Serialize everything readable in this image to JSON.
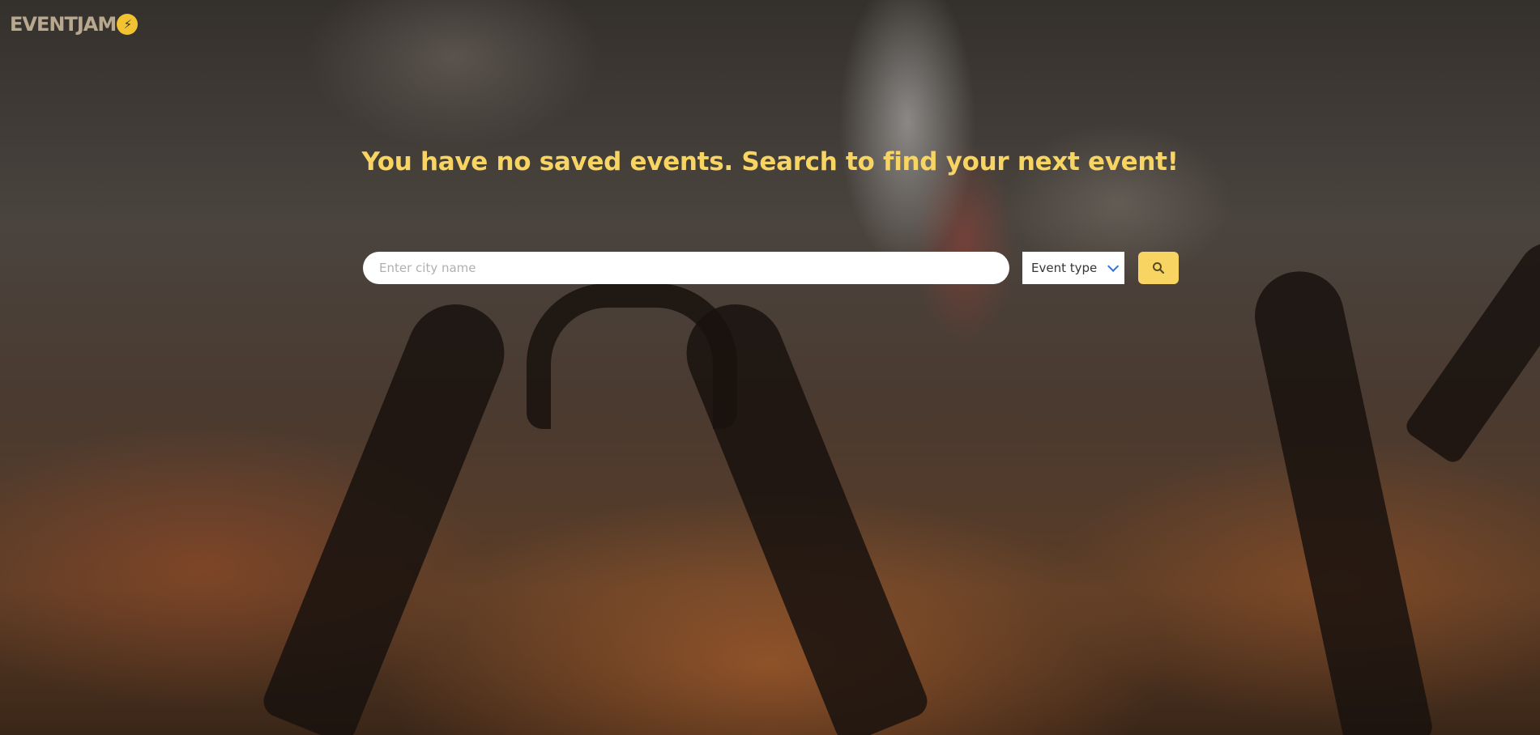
{
  "brand": {
    "logo_text": "EVENTJAM",
    "logo_icon": "lightning-globe-icon",
    "accent_color": "#f8d462"
  },
  "main": {
    "headline": "You have no saved events. Search to find your next event!"
  },
  "search": {
    "city_placeholder": "Enter city name",
    "city_value": "",
    "event_type_selected": "Event type",
    "search_icon": "search-icon"
  }
}
